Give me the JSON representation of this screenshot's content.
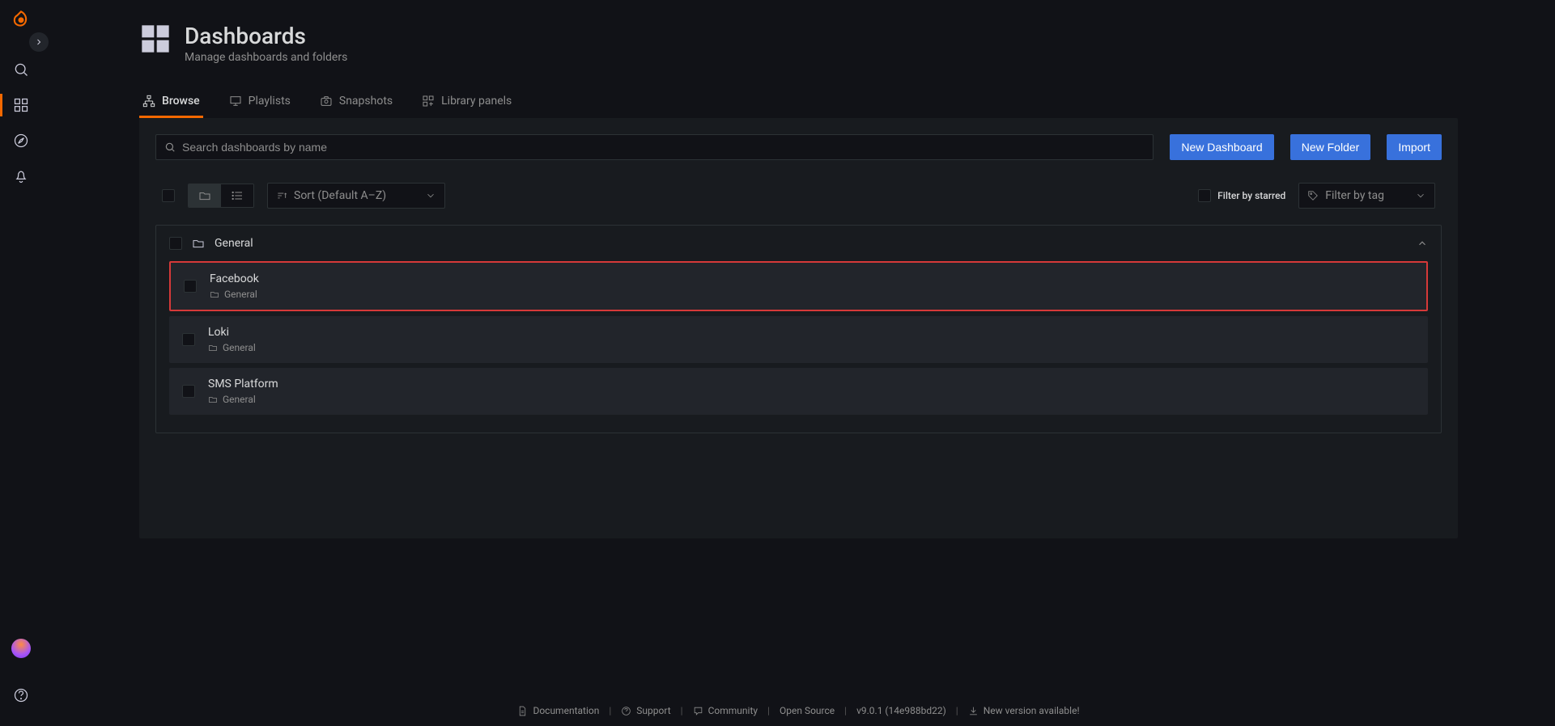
{
  "page": {
    "title": "Dashboards",
    "subtitle": "Manage dashboards and folders"
  },
  "tabs": [
    {
      "label": "Browse"
    },
    {
      "label": "Playlists"
    },
    {
      "label": "Snapshots"
    },
    {
      "label": "Library panels"
    }
  ],
  "search": {
    "placeholder": "Search dashboards by name"
  },
  "buttons": {
    "newDashboard": "New Dashboard",
    "newFolder": "New Folder",
    "import": "Import"
  },
  "toolbar": {
    "sortLabel": "Sort (Default A–Z)",
    "filterStarred": "Filter by starred",
    "filterTag": "Filter by tag"
  },
  "folder": {
    "name": "General"
  },
  "dashboards": [
    {
      "name": "Facebook",
      "folder": "General",
      "highlighted": true
    },
    {
      "name": "Loki",
      "folder": "General",
      "highlighted": false
    },
    {
      "name": "SMS Platform",
      "folder": "General",
      "highlighted": false
    }
  ],
  "footer": {
    "documentation": "Documentation",
    "support": "Support",
    "community": "Community",
    "openSource": "Open Source",
    "version": "v9.0.1 (14e988bd22)",
    "newVersion": "New version available!"
  }
}
